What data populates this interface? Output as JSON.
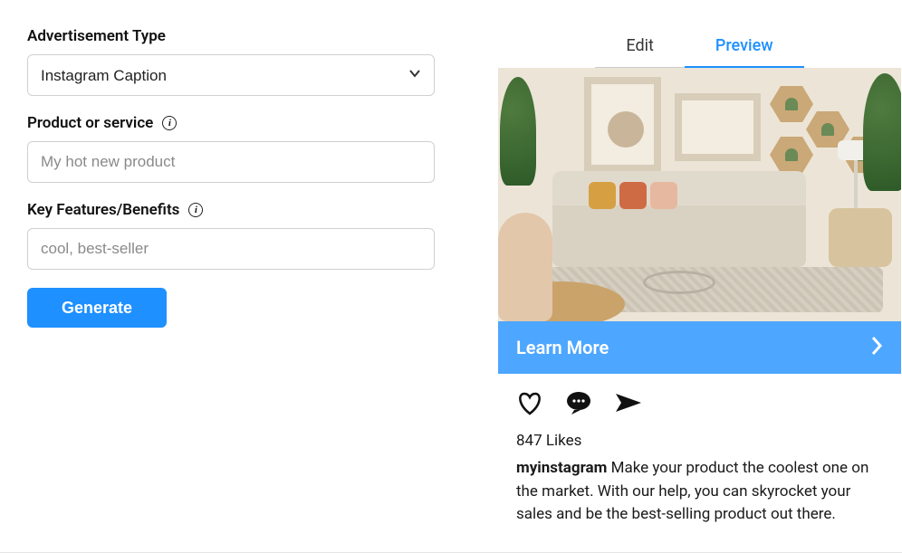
{
  "form": {
    "ad_type": {
      "label": "Advertisement Type",
      "value": "Instagram Caption"
    },
    "product": {
      "label": "Product or service",
      "placeholder": "My hot new product"
    },
    "features": {
      "label": "Key Features/Benefits",
      "placeholder": "cool, best-seller"
    },
    "generate_label": "Generate"
  },
  "tabs": {
    "edit": "Edit",
    "preview": "Preview",
    "active": "preview"
  },
  "preview": {
    "cta_label": "Learn More",
    "likes": "847 Likes",
    "username": "myinstagram",
    "caption": "Make your product the coolest one on the market. With our help, you can skyrocket your sales and be the best-selling product out there."
  }
}
